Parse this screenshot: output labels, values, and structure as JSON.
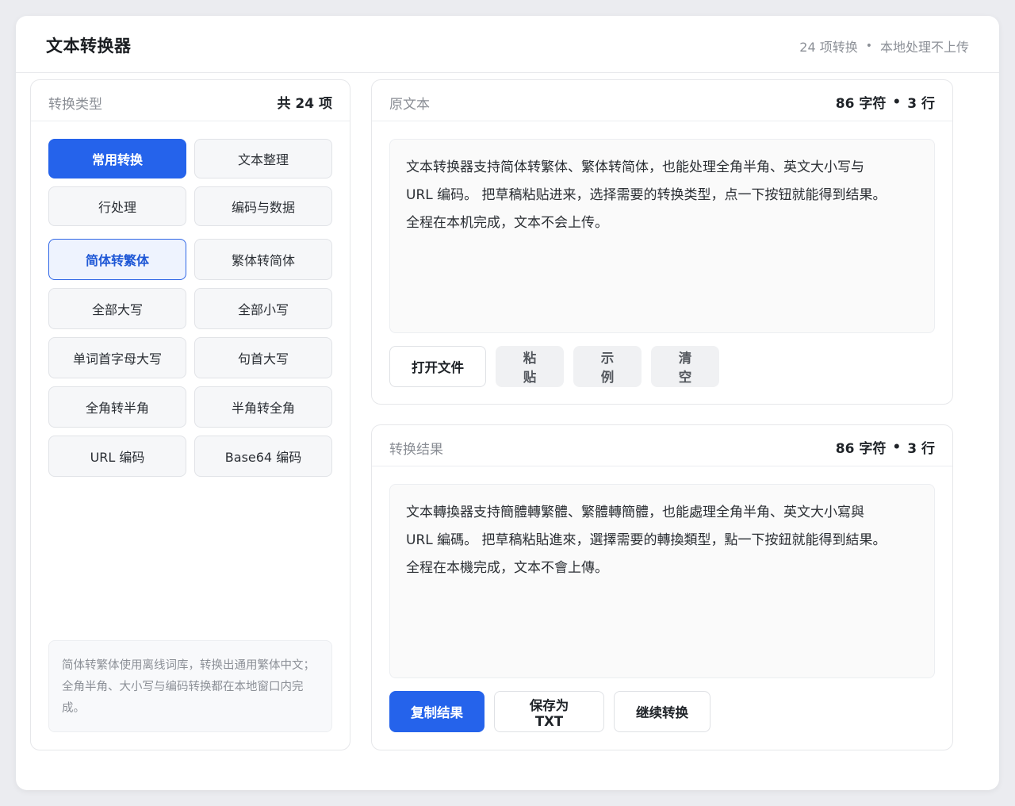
{
  "header": {
    "title": "文本转换器",
    "meta_count": "24 项转换",
    "meta_sep": "•",
    "meta_note": "本地处理不上传"
  },
  "sidebar": {
    "title": "转换类型",
    "count": "共 24 项",
    "categories": [
      {
        "label": "常用转换",
        "state": "primary"
      },
      {
        "label": "文本整理",
        "state": "normal"
      },
      {
        "label": "行处理",
        "state": "normal"
      },
      {
        "label": "编码与数据",
        "state": "normal"
      }
    ],
    "conversions": [
      {
        "label": "简体转繁体",
        "state": "selected"
      },
      {
        "label": "繁体转简体",
        "state": "normal"
      },
      {
        "label": "全部大写",
        "state": "normal"
      },
      {
        "label": "全部小写",
        "state": "normal"
      },
      {
        "label": "单词首字母大写",
        "state": "normal"
      },
      {
        "label": "句首大写",
        "state": "normal"
      },
      {
        "label": "全角转半角",
        "state": "normal"
      },
      {
        "label": "半角转全角",
        "state": "normal"
      },
      {
        "label": "URL 编码",
        "state": "normal"
      },
      {
        "label": "Base64 编码",
        "state": "normal"
      }
    ],
    "note": "简体转繁体使用离线词库，转换出通用繁体中文；全角半角、大小写与编码转换都在本地窗口内完成。"
  },
  "source": {
    "title": "原文本",
    "chars": "86 字符",
    "sep": "•",
    "lines": "3 行",
    "text": "文本转换器支持简体转繁体、繁体转简体，也能处理全角半角、英文大小写与\nURL 编码。 把草稿粘贴进来，选择需要的转换类型，点一下按钮就能得到结果。\n全程在本机完成，文本不会上传。",
    "buttons": {
      "open": "打开文件",
      "paste": "粘贴",
      "example": "示例",
      "clear": "清空"
    }
  },
  "result": {
    "title": "转换结果",
    "chars": "86 字符",
    "sep": "•",
    "lines": "3 行",
    "text": "文本轉換器支持簡體轉繁體、繁體轉簡體，也能處理全角半角、英文大小寫與\nURL 編碼。 把草稿粘貼進來，選擇需要的轉換類型，點一下按鈕就能得到結果。\n全程在本機完成，文本不會上傳。",
    "buttons": {
      "copy": "复制结果",
      "save": "保存为 TXT",
      "continue": "继续转换"
    }
  },
  "colors": {
    "accent": "#2563eb",
    "selected_bg": "#eef3fe",
    "muted": "#8c9097"
  }
}
